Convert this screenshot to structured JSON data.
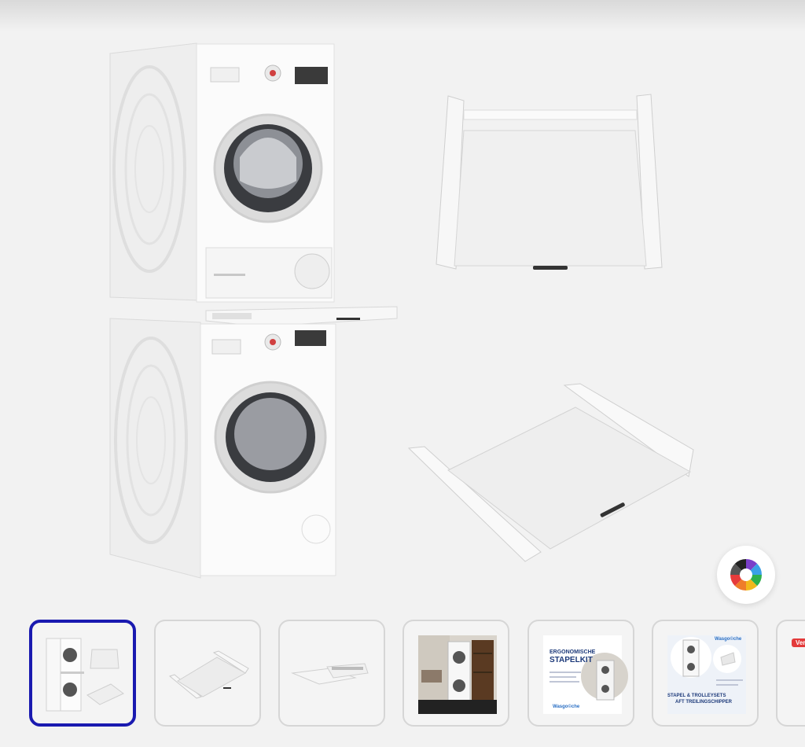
{
  "main_image": {
    "alt": "stacked-washer-dryer-with-pull-out-shelf"
  },
  "color_picker": {
    "icon": "color-wheel-icon",
    "colors": [
      "#7a3fc9",
      "#3aa0e6",
      "#2eb04c",
      "#f2b81c",
      "#ef7d2a",
      "#e63b3b",
      "#555555",
      "#222222"
    ]
  },
  "accent_color": "#1a1ab0",
  "thumbnails": [
    {
      "id": "thumb-1",
      "selected": true
    },
    {
      "id": "thumb-2",
      "selected": false
    },
    {
      "id": "thumb-3",
      "selected": false
    },
    {
      "id": "thumb-4",
      "selected": false
    },
    {
      "id": "thumb-5",
      "heading_line1": "ERGONOMISCHE",
      "heading_line2": "STAPELKIT",
      "brand": "Wasgo©che"
    },
    {
      "id": "thumb-6",
      "brand": "Wasgo©che",
      "footer_line1": "STAPEL & TROLLEYSETS",
      "footer_line2": "AFT TREILINGSCHIPPER"
    },
    {
      "id": "thumb-7",
      "badge": "Verp"
    }
  ]
}
